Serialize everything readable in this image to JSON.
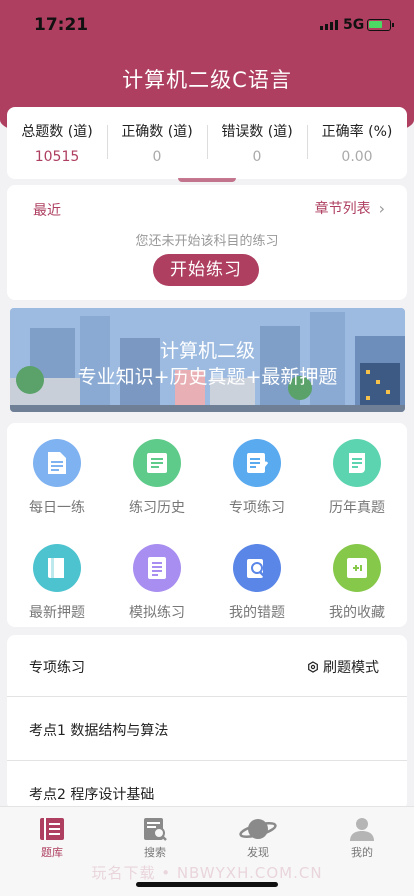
{
  "status": {
    "time": "17:21",
    "network": "5G"
  },
  "header": {
    "title": "计算机二级C语言"
  },
  "stats": [
    {
      "label": "总题数 (道)",
      "value": "10515"
    },
    {
      "label": "正确数 (道)",
      "value": "0"
    },
    {
      "label": "错误数 (道)",
      "value": "0"
    },
    {
      "label": "正确率 (%)",
      "value": "0.00"
    }
  ],
  "recent": {
    "recent_label": "最近",
    "chapter_list_label": "章节列表",
    "tip": "您还未开始该科目的练习",
    "start_button": "开始练习"
  },
  "banner": {
    "line1": "计算机二级",
    "line2": "专业知识+历史真题+最新押题"
  },
  "features": [
    {
      "label": "每日一练",
      "icon": "daily-practice-icon",
      "color": "#7fb2f0"
    },
    {
      "label": "练习历史",
      "icon": "practice-history-icon",
      "color": "#5fcb8a"
    },
    {
      "label": "专项练习",
      "icon": "special-practice-icon",
      "color": "#5aaaf0"
    },
    {
      "label": "历年真题",
      "icon": "past-exams-icon",
      "color": "#5dd4b0"
    },
    {
      "label": "最新押题",
      "icon": "latest-predictions-icon",
      "color": "#4cc3cf"
    },
    {
      "label": "模拟练习",
      "icon": "mock-practice-icon",
      "color": "#a88ef0"
    },
    {
      "label": "我的错题",
      "icon": "my-mistakes-icon",
      "color": "#5a86e8"
    },
    {
      "label": "我的收藏",
      "icon": "my-favorites-icon",
      "color": "#86c84a"
    }
  ],
  "practice": {
    "title": "专项练习",
    "mode": "刷题模式",
    "items": [
      "考点1 数据结构与算法",
      "考点2 程序设计基础"
    ]
  },
  "tabs": [
    {
      "label": "题库",
      "icon": "question-bank-icon"
    },
    {
      "label": "搜索",
      "icon": "search-icon"
    },
    {
      "label": "发现",
      "icon": "discover-planet-icon"
    },
    {
      "label": "我的",
      "icon": "profile-icon"
    }
  ],
  "watermark": "玩名下载 • NBWYXH.COM.CN",
  "colors": {
    "brand": "#ae3f60"
  }
}
